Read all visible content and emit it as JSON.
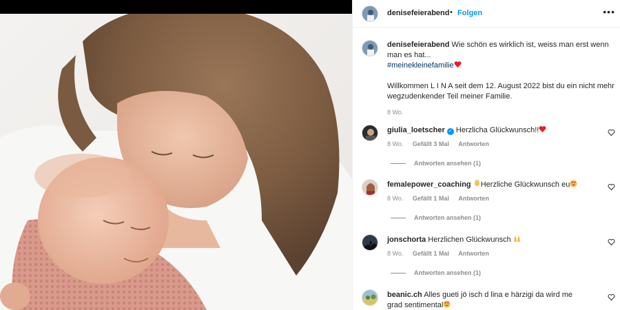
{
  "post": {
    "username": "denisefeierabend",
    "separator": "•",
    "follow_label": "Folgen",
    "more_label": "•••"
  },
  "caption": {
    "username": "denisefeierabend",
    "text_line1": "Wie schön es wirklich ist, weiss man erst wenn man es hat...",
    "hashtag": "#meinekleinefamilie",
    "text_line2": "Willkommen L I N A seit dem 12. August 2022 bist du ein nicht mehr wegzudenkender Teil meiner Familie.",
    "time": "8 Wo."
  },
  "comments": [
    {
      "username": "giulia_loetscher",
      "verified": true,
      "text": "Herzlicha Glückwunsch!!",
      "emoji": "red-heart",
      "time": "8 Wo.",
      "likes": "Gefällt 3 Mal",
      "reply": "Antworten",
      "view_replies": "Antworten ansehen (1)"
    },
    {
      "username": "femalepower_coaching",
      "verified": false,
      "emoji_prefix": "baby-angel",
      "text": "Herzliche Glückwunsch eu",
      "emoji": "heart-eyes",
      "time": "8 Wo.",
      "likes": "Gefällt 1 Mal",
      "reply": "Antworten",
      "view_replies": "Antworten ansehen (1)"
    },
    {
      "username": "jonschorta",
      "verified": false,
      "text": "Herzlichen Glückwunsch",
      "emoji": "raising-hands",
      "time": "8 Wo.",
      "likes": "Gefällt 1 Mal",
      "reply": "Antworten",
      "view_replies": "Antworten ansehen (1)"
    },
    {
      "username": "beanic.ch",
      "verified": false,
      "text": "Alles gueti jö isch d lina e härzigi da wird me grad sentimental",
      "emoji": "heart-eyes"
    }
  ],
  "colors": {
    "link_blue": "#0095f6",
    "hashtag_blue": "#00376b",
    "meta_gray": "#8e8e8e",
    "heart_red": "#ed4956"
  }
}
